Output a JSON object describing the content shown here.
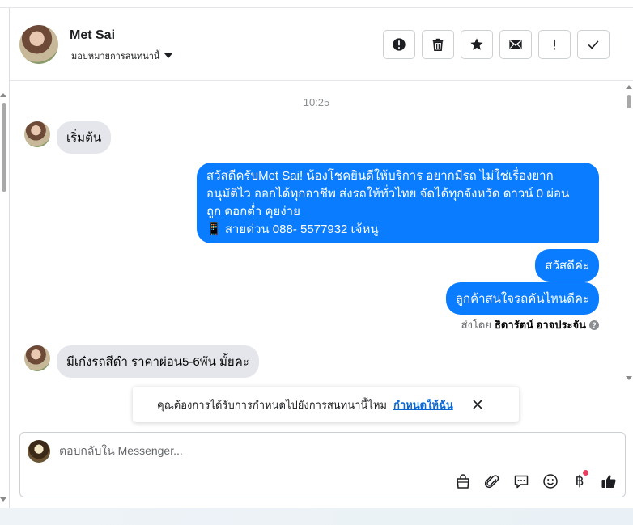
{
  "header": {
    "contact_name": "Met Sai",
    "assign_label": "มอบหมายการสนทนานี้"
  },
  "toolbar": {
    "buttons": [
      {
        "name": "report-button",
        "icon": "alert-circle-icon"
      },
      {
        "name": "delete-button",
        "icon": "trash-icon"
      },
      {
        "name": "star-button",
        "icon": "star-icon"
      },
      {
        "name": "mark-unread-button",
        "icon": "envelope-icon"
      },
      {
        "name": "follow-up-button",
        "icon": "exclamation-icon"
      },
      {
        "name": "done-button",
        "icon": "check-icon"
      }
    ]
  },
  "chat": {
    "timestamp": "10:25",
    "messages": [
      {
        "dir": "in",
        "text": "เริ่มต้น"
      },
      {
        "dir": "out",
        "lines": [
          "สวัสดีครับMet Sai! น้องโชคยินดีให้บริการ อยากมีรถ ไม่ใช่เรื่องยาก",
          "อนุมัติไว ออกได้ทุกอาชีพ ส่งรถให้ทั่วไทย จัดได้ทุกจังหวัด ดาวน์ 0  ผ่อน",
          "ถูก ดอกต่ำ คุยง่าย",
          "📱 สายด่วน 088- 5577932 เจ้หนู"
        ]
      },
      {
        "dir": "out",
        "text": "สวัสดีค่ะ"
      },
      {
        "dir": "out",
        "text": "ลูกค้าสนใจรถคันไหนดีคะ"
      },
      {
        "dir": "in",
        "text": "มีเก๋งรถสีดำ ราคาผ่อน5-6พัน มั้ยคะ"
      }
    ],
    "sent_by_prefix": "ส่งโดย",
    "sent_by_name": "ธิดารัตน์ อาจประจัน",
    "sent_by_info": "?"
  },
  "assign_banner": {
    "text": "คุณต้องการได้รับการกำหนดไปยังการสนทนานี้ไหม",
    "link": "กำหนดให้ฉัน"
  },
  "composer": {
    "placeholder": "ตอบกลับใน Messenger...",
    "currency_symbol": "฿"
  },
  "colors": {
    "outgoing_bubble": "#0a7cff",
    "incoming_bubble": "#e4e6eb",
    "link": "#0a66d1",
    "notification_dot": "#e4405f"
  }
}
